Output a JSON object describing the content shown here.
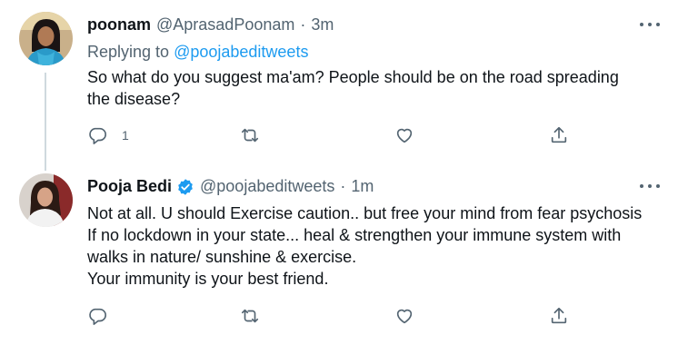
{
  "tweets": [
    {
      "name": "poonam",
      "handle": "@AprasadPoonam",
      "separator": "·",
      "time": "3m",
      "replying_label": "Replying to",
      "replying_to": "@poojabeditweets",
      "text_lines": [
        "So what do you suggest ma'am? People should be on the road spreading",
        "the disease?"
      ],
      "reply_count": "1",
      "avatar_icon": "woman-portrait-avatar",
      "icons": [
        "reply-icon",
        "retweet-icon",
        "like-icon",
        "share-icon",
        "more-icon"
      ]
    },
    {
      "name": "Pooja Bedi",
      "verified": true,
      "handle": "@poojabeditweets",
      "separator": "·",
      "time": "1m",
      "text_lines": [
        "Not at all. U should Exercise caution.. but free your mind from fear psychosis",
        "If no lockdown in your state... heal & strengthen your immune system with",
        "walks in nature/ sunshine & exercise.",
        "Your immunity is your best friend."
      ],
      "avatar_icon": "woman-portrait-avatar",
      "icons": [
        "reply-icon",
        "retweet-icon",
        "like-icon",
        "share-icon",
        "more-icon",
        "verified-badge-icon"
      ]
    }
  ],
  "colors": {
    "text": "#0f1419",
    "secondary": "#536471",
    "accent": "#1d9bf0",
    "thread_line": "#cfd9de"
  }
}
